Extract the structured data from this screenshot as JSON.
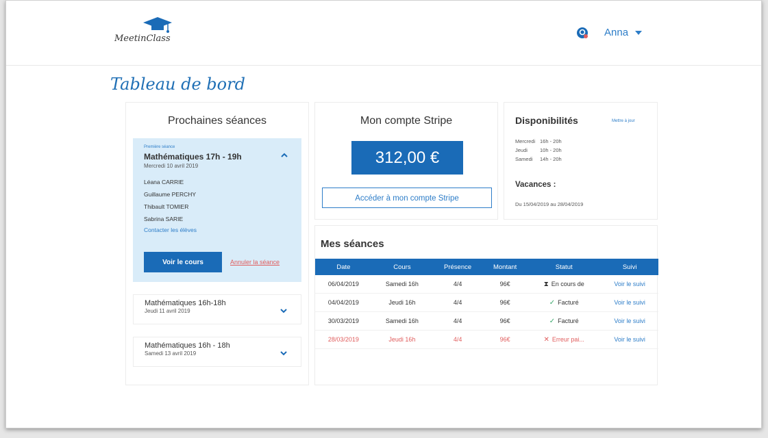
{
  "header": {
    "logo_text": "MeetinClass",
    "user_name": "Anna"
  },
  "page": {
    "title": "Tableau de bord"
  },
  "upcoming": {
    "title": "Prochaines séances",
    "open_session": {
      "tag": "Première séance",
      "title": "Mathématiques 17h - 19h",
      "date": "Mercredi 10 avril 2019",
      "students": [
        "Léana CARRIE",
        "Guillaume PERCHY",
        "Thibault TOMIER",
        "Sabrina SARIE"
      ],
      "contact_label": "Contacter les élèves",
      "view_label": "Voir le cours",
      "cancel_label": "Annuler la séance"
    },
    "closed_sessions": [
      {
        "title": "Mathématiques 16h-18h",
        "date": "Jeudi 11 avril 2019"
      },
      {
        "title": "Mathématiques 16h - 18h",
        "date": "Samedi 13 avril 2019"
      }
    ]
  },
  "stripe": {
    "title": "Mon compte Stripe",
    "amount": "312,00 €",
    "button_label": "Accéder à mon compte Stripe"
  },
  "dispo": {
    "title": "Disponibilités",
    "update_label": "Mettre à jour",
    "rows": [
      {
        "day": "Mercredi",
        "hours": "16h  -  20h"
      },
      {
        "day": "Jeudi",
        "hours": "10h  -  20h"
      },
      {
        "day": "Samedi",
        "hours": "14h  -  20h"
      }
    ],
    "vacation_title": "Vacances :",
    "vacation_text": "Du 15/04/2019 au 28/04/2019"
  },
  "seances": {
    "title": "Mes séances",
    "columns": [
      "Date",
      "Cours",
      "Présence",
      "Montant",
      "Statut",
      "Suivi"
    ],
    "rows": [
      {
        "date": "06/04/2019",
        "course": "Samedi 16h",
        "presence": "4/4",
        "amount": "96€",
        "status": "En cours de",
        "icon": "hourglass-icon",
        "follow": "Voir le suivi",
        "error": false
      },
      {
        "date": "04/04/2019",
        "course": "Jeudi 16h",
        "presence": "4/4",
        "amount": "96€",
        "status": "Facturé",
        "icon": "check-icon",
        "follow": "Voir le suivi",
        "error": false
      },
      {
        "date": "30/03/2019",
        "course": "Samedi 16h",
        "presence": "4/4",
        "amount": "96€",
        "status": "Facturé",
        "icon": "check-icon",
        "follow": "Voir le suivi",
        "error": false
      },
      {
        "date": "28/03/2019",
        "course": "Jeudi 16h",
        "presence": "4/4",
        "amount": "96€",
        "status": "Erreur pai...",
        "icon": "cross-icon",
        "follow": "Voir le suivi",
        "error": true
      }
    ]
  },
  "colors": {
    "primary": "#1a6bb7",
    "link": "#2d7dc8",
    "highlight": "#d9ecf9",
    "error": "#e05d5d",
    "success": "#3aa86b"
  }
}
